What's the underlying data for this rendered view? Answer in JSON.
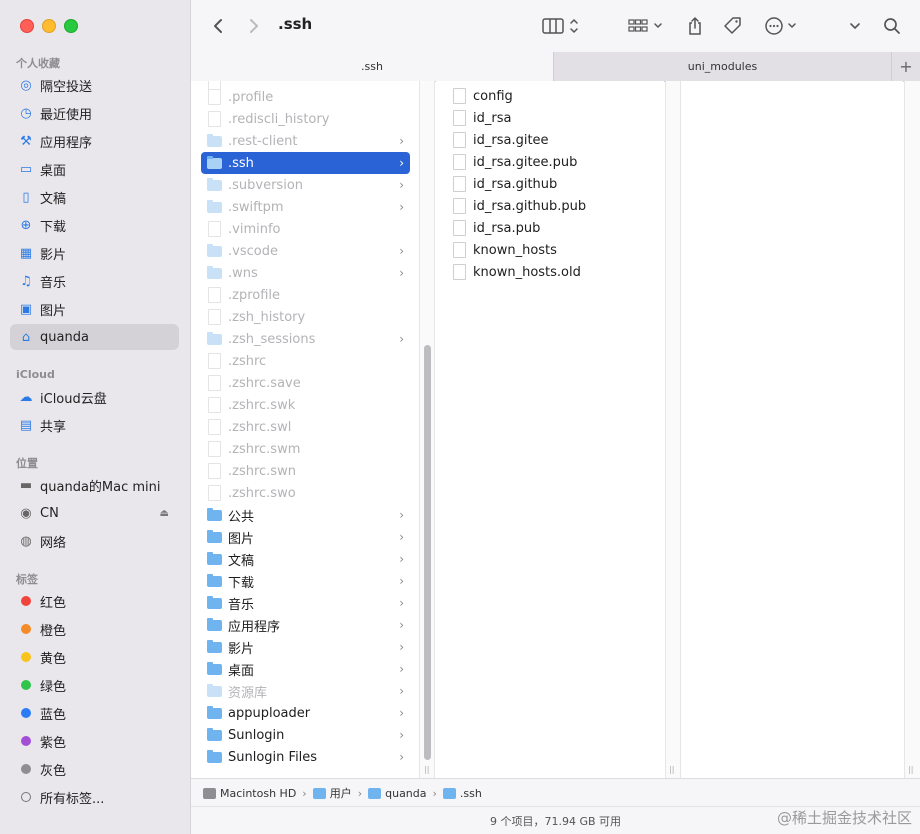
{
  "window": {
    "title": ".ssh"
  },
  "sidebar": {
    "favorites_title": "个人收藏",
    "favorites": [
      {
        "label": "隔空投送",
        "icon": "airdrop-icon"
      },
      {
        "label": "最近使用",
        "icon": "clock-icon"
      },
      {
        "label": "应用程序",
        "icon": "applications-icon"
      },
      {
        "label": "桌面",
        "icon": "desktop-icon"
      },
      {
        "label": "文稿",
        "icon": "document-icon"
      },
      {
        "label": "下载",
        "icon": "download-icon"
      },
      {
        "label": "影片",
        "icon": "film-icon"
      },
      {
        "label": "音乐",
        "icon": "music-icon"
      },
      {
        "label": "图片",
        "icon": "photo-icon"
      },
      {
        "label": "quanda",
        "icon": "home-icon"
      }
    ],
    "icloud_title": "iCloud",
    "icloud": [
      {
        "label": "iCloud云盘",
        "icon": "cloud-icon"
      },
      {
        "label": "共享",
        "icon": "shared-folder-icon"
      }
    ],
    "locations_title": "位置",
    "locations": [
      {
        "label": "quanda的Mac mini",
        "icon": "computer-icon"
      },
      {
        "label": "CN",
        "icon": "disc-icon"
      },
      {
        "label": "网络",
        "icon": "globe-icon"
      }
    ],
    "tags_title": "标签",
    "tags": [
      {
        "label": "红色",
        "color": "#f1443b"
      },
      {
        "label": "橙色",
        "color": "#f48b26"
      },
      {
        "label": "黄色",
        "color": "#f7c31c"
      },
      {
        "label": "绿色",
        "color": "#2fc44a"
      },
      {
        "label": "蓝色",
        "color": "#2c7cf6"
      },
      {
        "label": "紫色",
        "color": "#a24fd6"
      },
      {
        "label": "灰色",
        "color": "#8d8d92"
      },
      {
        "label": "所有标签...",
        "color": ""
      }
    ]
  },
  "tabs": [
    {
      "label": ".ssh"
    },
    {
      "label": "uni_modules"
    }
  ],
  "column1": [
    {
      "name": ".profile",
      "type": "file",
      "dim": true,
      "chevron": false
    },
    {
      "name": ".rediscli_history",
      "type": "file",
      "dim": true,
      "chevron": false
    },
    {
      "name": ".rest-client",
      "type": "folder",
      "dim": true,
      "chevron": true
    },
    {
      "name": ".ssh",
      "type": "folder",
      "dim": false,
      "chevron": true,
      "selected": true
    },
    {
      "name": ".subversion",
      "type": "folder",
      "dim": true,
      "chevron": true
    },
    {
      "name": ".swiftpm",
      "type": "folder",
      "dim": true,
      "chevron": true
    },
    {
      "name": ".viminfo",
      "type": "file",
      "dim": true,
      "chevron": false
    },
    {
      "name": ".vscode",
      "type": "folder",
      "dim": true,
      "chevron": true
    },
    {
      "name": ".wns",
      "type": "folder",
      "dim": true,
      "chevron": true
    },
    {
      "name": ".zprofile",
      "type": "file",
      "dim": true,
      "chevron": false
    },
    {
      "name": ".zsh_history",
      "type": "file",
      "dim": true,
      "chevron": false
    },
    {
      "name": ".zsh_sessions",
      "type": "folder",
      "dim": true,
      "chevron": true
    },
    {
      "name": ".zshrc",
      "type": "file",
      "dim": true,
      "chevron": false
    },
    {
      "name": ".zshrc.save",
      "type": "file",
      "dim": true,
      "chevron": false
    },
    {
      "name": ".zshrc.swk",
      "type": "file",
      "dim": true,
      "chevron": false
    },
    {
      "name": ".zshrc.swl",
      "type": "file",
      "dim": true,
      "chevron": false
    },
    {
      "name": ".zshrc.swm",
      "type": "file",
      "dim": true,
      "chevron": false
    },
    {
      "name": ".zshrc.swn",
      "type": "file",
      "dim": true,
      "chevron": false
    },
    {
      "name": ".zshrc.swo",
      "type": "file",
      "dim": true,
      "chevron": false
    },
    {
      "name": "公共",
      "type": "folder",
      "dim": false,
      "chevron": true
    },
    {
      "name": "图片",
      "type": "folder",
      "dim": false,
      "chevron": true
    },
    {
      "name": "文稿",
      "type": "folder",
      "dim": false,
      "chevron": true
    },
    {
      "name": "下载",
      "type": "folder",
      "dim": false,
      "chevron": true
    },
    {
      "name": "音乐",
      "type": "folder",
      "dim": false,
      "chevron": true
    },
    {
      "name": "应用程序",
      "type": "folder",
      "dim": false,
      "chevron": true
    },
    {
      "name": "影片",
      "type": "folder",
      "dim": false,
      "chevron": true
    },
    {
      "name": "桌面",
      "type": "folder",
      "dim": false,
      "chevron": true
    },
    {
      "name": "资源库",
      "type": "folder",
      "dim": true,
      "chevron": true
    },
    {
      "name": "appuploader",
      "type": "folder",
      "dim": false,
      "chevron": true
    },
    {
      "name": "Sunlogin",
      "type": "folder",
      "dim": false,
      "chevron": true
    },
    {
      "name": "Sunlogin Files",
      "type": "folder",
      "dim": false,
      "chevron": true
    }
  ],
  "column2": [
    {
      "name": "config"
    },
    {
      "name": "id_rsa"
    },
    {
      "name": "id_rsa.gitee"
    },
    {
      "name": "id_rsa.gitee.pub"
    },
    {
      "name": "id_rsa.github"
    },
    {
      "name": "id_rsa.github.pub"
    },
    {
      "name": "id_rsa.pub"
    },
    {
      "name": "known_hosts"
    },
    {
      "name": "known_hosts.old"
    }
  ],
  "pathbar": [
    {
      "label": "Macintosh HD",
      "icon": "hard-drive-icon"
    },
    {
      "label": "用户",
      "icon": "folder-icon"
    },
    {
      "label": "quanda",
      "icon": "home-folder-icon"
    },
    {
      "label": ".ssh",
      "icon": "folder-icon"
    }
  ],
  "status": "9 个项目，71.94 GB 可用",
  "watermark": "@稀土掘金技术社区"
}
